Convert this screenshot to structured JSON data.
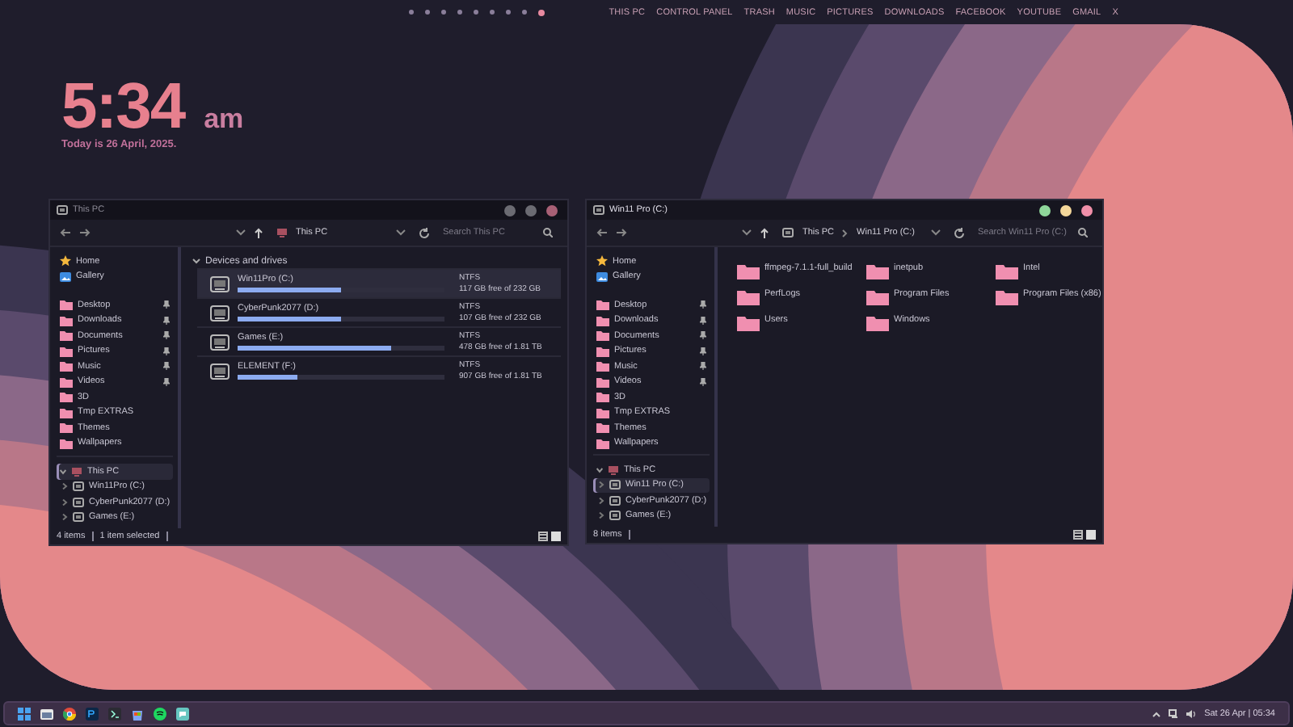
{
  "top_bar": {
    "dots": [
      {
        "selected": false
      },
      {
        "selected": false
      },
      {
        "selected": false
      },
      {
        "selected": false
      },
      {
        "selected": false
      },
      {
        "selected": false
      },
      {
        "selected": false
      },
      {
        "selected": false
      },
      {
        "selected": true
      }
    ],
    "links": [
      "THIS PC",
      "CONTROL PANEL",
      "TRASH",
      "MUSIC",
      "PICTURES",
      "DOWNLOADS",
      "FACEBOOK",
      "YOUTUBE",
      "GMAIL",
      "X"
    ]
  },
  "clock": {
    "time": "5:34",
    "meridiem": "am",
    "date": "Today is 26 April, 2025."
  },
  "windows": [
    {
      "active": false,
      "title": "This PC",
      "address": [
        "This PC"
      ],
      "search_placeholder": "Search This PC",
      "quick_access": [
        {
          "label": "Home",
          "kind": "home",
          "pinned": false
        },
        {
          "label": "Gallery",
          "kind": "gallery",
          "pinned": false
        },
        {
          "label": "Desktop",
          "kind": "folder",
          "pinned": true
        },
        {
          "label": "Downloads",
          "kind": "folder",
          "pinned": true
        },
        {
          "label": "Documents",
          "kind": "folder",
          "pinned": true
        },
        {
          "label": "Pictures",
          "kind": "folder",
          "pinned": true
        },
        {
          "label": "Music",
          "kind": "folder",
          "pinned": true
        },
        {
          "label": "Videos",
          "kind": "folder",
          "pinned": true
        },
        {
          "label": "3D",
          "kind": "folder",
          "pinned": false
        },
        {
          "label": "Tmp EXTRAS",
          "kind": "folder",
          "pinned": false
        },
        {
          "label": "Themes",
          "kind": "folder",
          "pinned": false
        },
        {
          "label": "Wallpapers",
          "kind": "folder",
          "pinned": false
        }
      ],
      "tree": [
        {
          "label": "This PC",
          "expanded": true,
          "selected": true,
          "children": [
            {
              "label": "Win11Pro (C:)",
              "selected": false
            },
            {
              "label": "CyberPunk2077 (D:)",
              "selected": false
            },
            {
              "label": "Games (E:)",
              "selected": false
            }
          ]
        }
      ],
      "content": {
        "kind": "drives",
        "heading": "Devices and drives",
        "drives": [
          {
            "name": "Win11Pro (C:)",
            "level": 0.5,
            "file_system": "NTFS",
            "free": "117 GB free of 232 GB",
            "selected": true
          },
          {
            "name": "CyberPunk2077 (D:)",
            "level": 0.5,
            "file_system": "NTFS",
            "free": "107 GB free of 232 GB",
            "selected": false
          },
          {
            "name": "Games (E:)",
            "level": 0.74,
            "file_system": "NTFS",
            "free": "478 GB free of 1.81 TB",
            "selected": false
          },
          {
            "name": "ELEMENT (F:)",
            "level": 0.29,
            "file_system": "NTFS",
            "free": "907 GB free of 1.81 TB",
            "selected": false
          }
        ]
      },
      "status": [
        "4 items",
        "1 item selected"
      ]
    },
    {
      "active": true,
      "title": "Win11 Pro (C:)",
      "address": [
        "This PC",
        "Win11 Pro (C:)"
      ],
      "search_placeholder": "Search Win11 Pro (C:)",
      "quick_access": [
        {
          "label": "Home",
          "kind": "home",
          "pinned": false
        },
        {
          "label": "Gallery",
          "kind": "gallery",
          "pinned": false
        },
        {
          "label": "Desktop",
          "kind": "folder",
          "pinned": true
        },
        {
          "label": "Downloads",
          "kind": "folder",
          "pinned": true
        },
        {
          "label": "Documents",
          "kind": "folder",
          "pinned": true
        },
        {
          "label": "Pictures",
          "kind": "folder",
          "pinned": true
        },
        {
          "label": "Music",
          "kind": "folder",
          "pinned": true
        },
        {
          "label": "Videos",
          "kind": "folder",
          "pinned": true
        },
        {
          "label": "3D",
          "kind": "folder",
          "pinned": false
        },
        {
          "label": "Tmp EXTRAS",
          "kind": "folder",
          "pinned": false
        },
        {
          "label": "Themes",
          "kind": "folder",
          "pinned": false
        },
        {
          "label": "Wallpapers",
          "kind": "folder",
          "pinned": false
        }
      ],
      "tree": [
        {
          "label": "This PC",
          "expanded": true,
          "selected": false,
          "children": [
            {
              "label": "Win11 Pro (C:)",
              "selected": true
            },
            {
              "label": "CyberPunk2077 (D:)",
              "selected": false
            },
            {
              "label": "Games (E:)",
              "selected": false
            }
          ]
        }
      ],
      "content": {
        "kind": "folders",
        "items": [
          "ffmpeg-7.1.1-full_build",
          "inetpub",
          "Intel",
          "PerfLogs",
          "Program Files",
          "Program Files (x86)",
          "Users",
          "Windows"
        ]
      },
      "status": [
        "8 items"
      ]
    }
  ],
  "taskbar": {
    "apps": [
      {
        "kind": "start"
      },
      {
        "kind": "files"
      },
      {
        "kind": "browser"
      },
      {
        "kind": "photo"
      },
      {
        "kind": "terminal"
      },
      {
        "kind": "store"
      },
      {
        "kind": "music"
      },
      {
        "kind": "chat"
      }
    ],
    "tray_time": "Sat 26 Apr | 05:34"
  }
}
